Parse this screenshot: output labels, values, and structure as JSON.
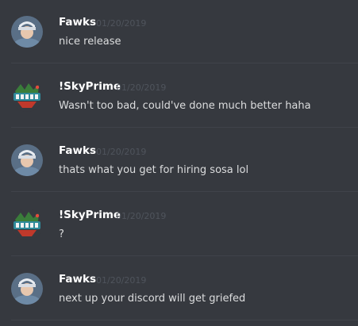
{
  "messages": [
    {
      "author": "Fawks",
      "timestamp": "01/20/2019",
      "text": "nice release",
      "avatar_icon": "fawks-avatar-icon"
    },
    {
      "author": "!SkyPrime",
      "timestamp": "01/20/2019",
      "text": "Wasn't too bad, could've done much better haha",
      "avatar_icon": "skyprime-avatar-icon"
    },
    {
      "author": "Fawks",
      "timestamp": "01/20/2019",
      "text": "thats what you get for hiring sosa lol",
      "avatar_icon": "fawks-avatar-icon"
    },
    {
      "author": "!SkyPrime",
      "timestamp": "01/20/2019",
      "text": "?",
      "avatar_icon": "skyprime-avatar-icon"
    },
    {
      "author": "Fawks",
      "timestamp": "01/20/2019",
      "text": "next up your discord will get griefed",
      "avatar_icon": "fawks-avatar-icon"
    }
  ],
  "colors": {
    "background": "#36393f",
    "username": "#ffffff",
    "timestamp": "#4f545c",
    "message_text": "#dcddde",
    "divider": "#40434a"
  }
}
